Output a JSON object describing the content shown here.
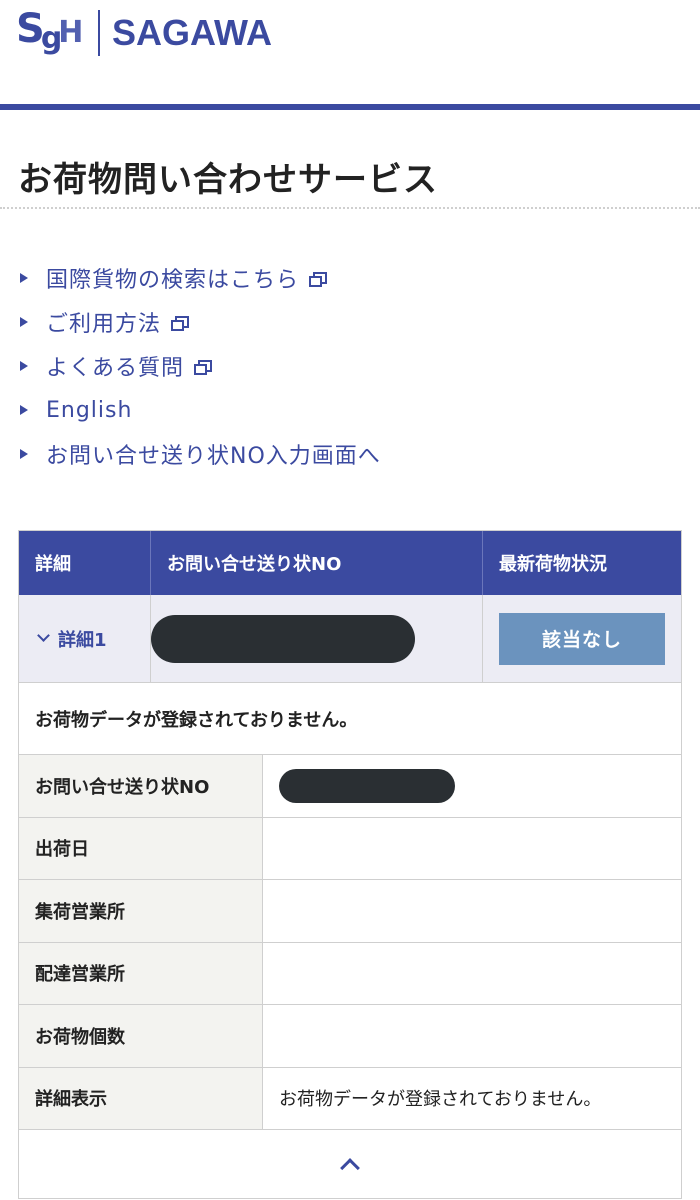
{
  "header": {
    "logo_mark": "SgH",
    "logo_text": "SAGAWA"
  },
  "page": {
    "title": "お荷物問い合わせサービス"
  },
  "links": [
    {
      "label": "国際貨物の検索はこちら",
      "external": true
    },
    {
      "label": "ご利用方法",
      "external": true
    },
    {
      "label": "よくある質問",
      "external": true
    },
    {
      "label": "English",
      "external": false
    },
    {
      "label": "お問い合せ送り状NO入力画面へ",
      "external": false
    }
  ],
  "table": {
    "headers": {
      "detail": "詳細",
      "tracking_no": "お問い合せ送り状NO",
      "status": "最新荷物状況"
    },
    "summary_row": {
      "detail_label": "詳細1",
      "status_label": "該当なし"
    },
    "message": "お荷物データが登録されておりません。",
    "details": [
      {
        "label": "お問い合せ送り状NO",
        "value": ""
      },
      {
        "label": "出荷日",
        "value": ""
      },
      {
        "label": "集荷営業所",
        "value": ""
      },
      {
        "label": "配達営業所",
        "value": ""
      },
      {
        "label": "お荷物個数",
        "value": ""
      },
      {
        "label": "詳細表示",
        "value": "お荷物データが登録されておりません。"
      }
    ]
  },
  "colors": {
    "brand": "#3b4aa0",
    "status_button": "#6b93be",
    "label_bg": "#f3f3f0"
  }
}
